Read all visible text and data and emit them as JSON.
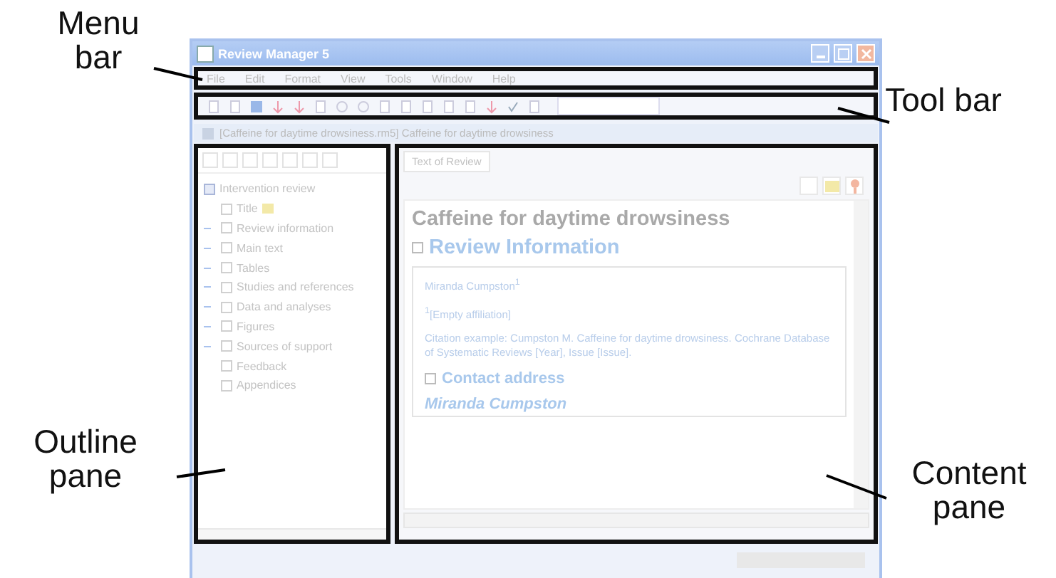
{
  "window": {
    "title": "Review Manager 5"
  },
  "menu_bar": {
    "items": [
      "File",
      "Edit",
      "Format",
      "View",
      "Tools",
      "Window",
      "Help"
    ]
  },
  "document_title": "[Caffeine for daytime drowsiness.rm5] Caffeine for daytime drowsiness",
  "outline": {
    "items": [
      {
        "label": "Intervention review",
        "kind": "root",
        "children": [
          {
            "label": "Title",
            "kind": "leaf"
          },
          {
            "label": "Review information",
            "kind": "group"
          },
          {
            "label": "Main text",
            "kind": "group"
          },
          {
            "label": "Tables",
            "kind": "group"
          },
          {
            "label": "Studies and references",
            "kind": "group"
          },
          {
            "label": "Data and analyses",
            "kind": "group"
          },
          {
            "label": "Figures",
            "kind": "group"
          },
          {
            "label": "Sources of support",
            "kind": "group"
          },
          {
            "label": "Feedback",
            "kind": "leaf"
          },
          {
            "label": "Appendices",
            "kind": "leaf"
          }
        ]
      }
    ]
  },
  "content": {
    "tabs": [
      {
        "label": "Text of Review",
        "selected": true
      }
    ],
    "title": "Caffeine for daytime drowsiness",
    "section": "Review Information",
    "author": "Miranda Cumpston$^{1}$",
    "affiliation": "$^{1}$[Empty affiliation]",
    "citation": "Citation example: Cumpston M. Caffeine for daytime drowsiness. Cochrane Database of Systematic Reviews [Year], Issue [Issue].",
    "subsection": "Contact address",
    "contact_name": "Miranda Cumpston"
  },
  "callouts": [
    {
      "label": "Menu bar",
      "kind": "menu"
    },
    {
      "label": "Tool bar",
      "kind": "toolbar"
    },
    {
      "label": "Outline pane",
      "kind": "outline"
    },
    {
      "label": "Content pane",
      "kind": "content"
    }
  ]
}
